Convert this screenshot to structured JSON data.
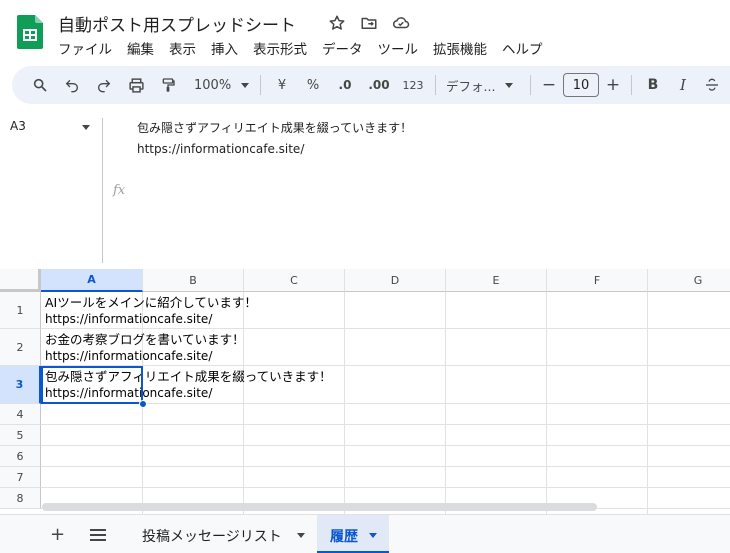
{
  "app": {
    "title": "自動ポスト用スプレッドシート",
    "brand_color": "#0f9d58",
    "accent_color": "#0b57d0"
  },
  "title_icons": [
    "star-icon",
    "move-to-folder-icon",
    "cloud-saved-icon"
  ],
  "menu": [
    "ファイル",
    "編集",
    "表示",
    "挿入",
    "表示形式",
    "データ",
    "ツール",
    "拡張機能",
    "ヘルプ"
  ],
  "toolbar": {
    "zoom": "100%",
    "currency": "¥",
    "percent": "%",
    "decrease_decimal": ".0",
    "increase_decimal": ".00",
    "number_format": "123",
    "font": "デフォ...",
    "font_size": "10",
    "bold": "B",
    "italic": "I"
  },
  "formula_bar": {
    "cell_ref": "A3",
    "fx": "fx",
    "line1": "包み隠さずアフィリエイト成果を綴っていきます！",
    "line2": "https://informationcafe.site/"
  },
  "grid": {
    "columns": [
      "A",
      "B",
      "C",
      "D",
      "E",
      "F",
      "G"
    ],
    "selected_column": "A",
    "rows": [
      "1",
      "2",
      "3",
      "4",
      "5",
      "6",
      "7",
      "8"
    ],
    "selected_row": "3",
    "cells": [
      {
        "line1": "AIツールをメインに紹介しています！",
        "line2": "https://informationcafe.site/"
      },
      {
        "line1": "お金の考察ブログを書いています！",
        "line2": "https://informationcafe.site/"
      },
      {
        "line1": "包み隠さずアフィリエイト成果を綴っていきます！",
        "line2": "https://informationcafe.site/"
      }
    ]
  },
  "sheets": {
    "tabs": [
      "投稿メッセージリスト",
      "履歴"
    ],
    "active": "履歴"
  }
}
